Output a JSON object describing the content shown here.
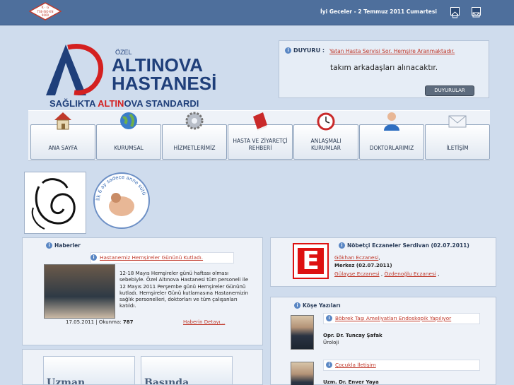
{
  "topbar": {
    "greeting": "İyi Geceler   -  2 Temmuz 2011 Cumartesi",
    "cert": {
      "l1": "K · G",
      "l2": "TSE-ISO-EN",
      "l3": "9000"
    }
  },
  "logo": {
    "ozel": "ÖZEL",
    "line1": "ALTINOVA",
    "line2": "HASTANESİ",
    "tag_a": "SAĞLIKTA ",
    "tag_b": "ALTIN",
    "tag_c": "OVA STANDARDI"
  },
  "duyuru": {
    "label": "DUYURU :",
    "link": "Yatan Hasta Servisi Sor. Hemşire Aranmaktadır.",
    "body": "takım arkadaşları alınacaktır.",
    "button": "DUYURULAR"
  },
  "nav": [
    {
      "label": "ANA SAYFA",
      "icon": "home-icon"
    },
    {
      "label": "KURUMSAL",
      "icon": "globe-icon"
    },
    {
      "label": "HİZMETLERİMİZ",
      "icon": "gear-icon"
    },
    {
      "label": "HASTA VE ZİYARETÇİ\nREHBERİ",
      "icon": "book-icon"
    },
    {
      "label": "ANLAŞMALI\nKURUMLAR",
      "icon": "clock-icon"
    },
    {
      "label": "DOKTORLARIMIZ",
      "icon": "doctor-icon"
    },
    {
      "label": "İLETİŞİM",
      "icon": "envelope-icon"
    }
  ],
  "badge": {
    "circle_text": "İlk 6 ay sadece anne sütü"
  },
  "haberler": {
    "title": "Haberler",
    "headline": "Hastanemiz Hemşireler Gününü Kutladı.",
    "body": "12-18 Mayıs Hemşireler günü haftası olması sebebiyle. Özel Altınova Hastanesi tüm personeli ile 12 Mayıs 2011 Perşembe günü Hemşireler Gününü kutladı. Hemşireler Günü kutlamasına Hastanemizin sağlık personelleri, doktorları ve tüm çalışanları katıldı.",
    "date": "17.05.2011",
    "okunma_label": " | Okunma: ",
    "okunma": "787",
    "more": "Haberin Detayı..."
  },
  "eczane": {
    "title": "Nöbetçi Eczaneler Serdivan (02.07.2011)",
    "e": "E",
    "p1": "Gökhan Eczanesi",
    "sep": ",",
    "merkez": "Merkez (02.07.2011)",
    "p2": "Gülayşe Eczanesi",
    "p3": "Özdenoğlu Eczanesi",
    "sep2": " , ",
    "sep3": " ,"
  },
  "kose": {
    "title": "Köşe Yazıları",
    "items": [
      {
        "link": "Böbrek Taşı Ameliyatları Endoskopik Yapılıyor",
        "name": "Opr. Dr. Tuncay Şafak",
        "spec": "Üroloji"
      },
      {
        "link": "Çocukla İletişim",
        "name": "Uzm. Dr. Enver Yaya",
        "spec": ""
      }
    ]
  },
  "promos": [
    {
      "text": "Uzman"
    },
    {
      "text": "Başında"
    }
  ]
}
